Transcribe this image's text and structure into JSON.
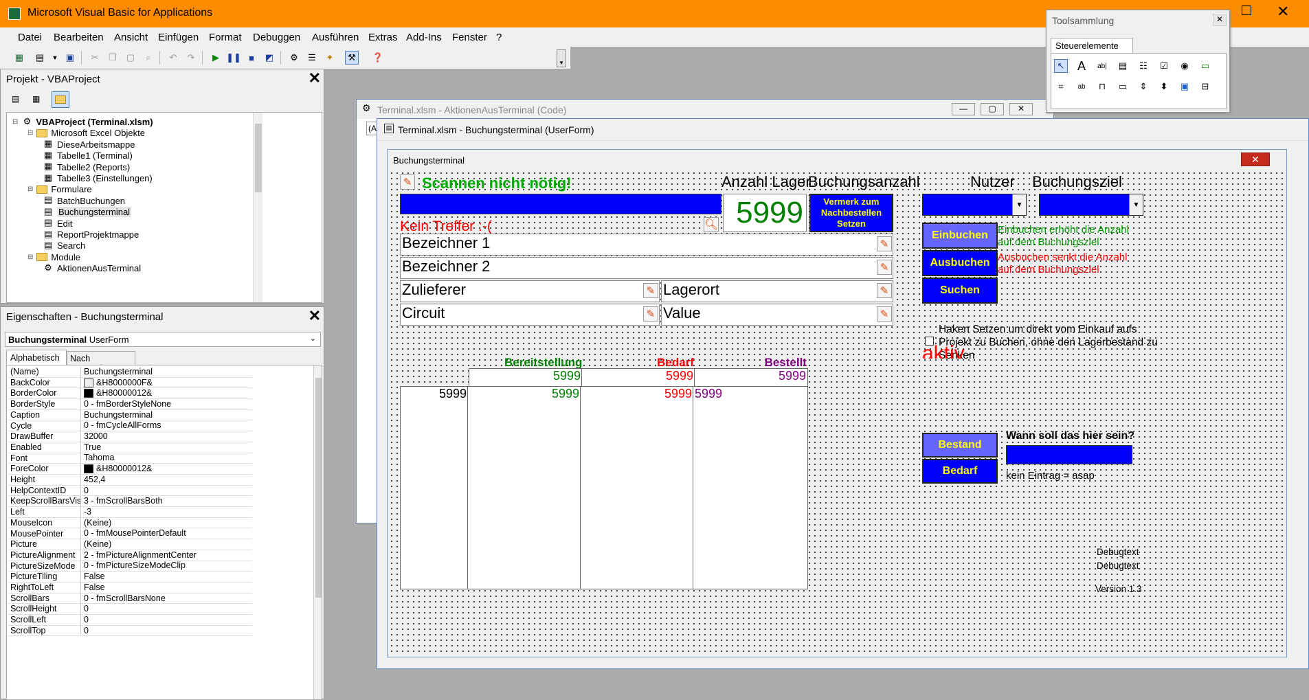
{
  "app": {
    "title": "Microsoft Visual Basic for Applications"
  },
  "menu": [
    "Datei",
    "Bearbeiten",
    "Ansicht",
    "Einfügen",
    "Format",
    "Debuggen",
    "Ausführen",
    "Extras",
    "Add-Ins",
    "Fenster",
    "?"
  ],
  "project": {
    "title": "Projekt - VBAProject",
    "tree": [
      {
        "label": "VBAProject (Terminal.xlsm)",
        "level": 0,
        "bold": true,
        "icon": "project-icon"
      },
      {
        "label": "Microsoft Excel Objekte",
        "level": 1,
        "icon": "folder-icon"
      },
      {
        "label": "DieseArbeitsmappe",
        "level": 2,
        "icon": "workbook-icon"
      },
      {
        "label": "Tabelle1 (Terminal)",
        "level": 2,
        "icon": "sheet-icon"
      },
      {
        "label": "Tabelle2 (Reports)",
        "level": 2,
        "icon": "sheet-icon"
      },
      {
        "label": "Tabelle3 (Einstellungen)",
        "level": 2,
        "icon": "sheet-icon"
      },
      {
        "label": "Formulare",
        "level": 1,
        "icon": "folder-icon"
      },
      {
        "label": "BatchBuchungen",
        "level": 2,
        "icon": "form-icon"
      },
      {
        "label": "Buchungsterminal",
        "level": 2,
        "icon": "form-icon",
        "selected": true
      },
      {
        "label": "Edit",
        "level": 2,
        "icon": "form-icon"
      },
      {
        "label": "ReportProjektmappe",
        "level": 2,
        "icon": "form-icon"
      },
      {
        "label": "Search",
        "level": 2,
        "icon": "form-icon"
      },
      {
        "label": "Module",
        "level": 1,
        "icon": "folder-icon"
      },
      {
        "label": "AktionenAusTerminal",
        "level": 2,
        "icon": "module-icon"
      }
    ]
  },
  "properties": {
    "title": "Eigenschaften - Buchungsterminal",
    "object_name": "Buchungsterminal",
    "object_type": "UserForm",
    "tabs": [
      "Alphabetisch",
      "Nach Kategorien"
    ],
    "rows": [
      {
        "name": "(Name)",
        "value": "Buchungsterminal"
      },
      {
        "name": "BackColor",
        "value": "&H8000000F&",
        "swatch": "#f0f0f0"
      },
      {
        "name": "BorderColor",
        "value": "&H80000012&",
        "swatch": "#000000"
      },
      {
        "name": "BorderStyle",
        "value": "0 - fmBorderStyleNone"
      },
      {
        "name": "Caption",
        "value": "Buchungsterminal"
      },
      {
        "name": "Cycle",
        "value": "0 - fmCycleAllForms"
      },
      {
        "name": "DrawBuffer",
        "value": "32000"
      },
      {
        "name": "Enabled",
        "value": "True"
      },
      {
        "name": "Font",
        "value": "Tahoma"
      },
      {
        "name": "ForeColor",
        "value": "&H80000012&",
        "swatch": "#000000"
      },
      {
        "name": "Height",
        "value": "452,4"
      },
      {
        "name": "HelpContextID",
        "value": "0"
      },
      {
        "name": "KeepScrollBarsVisible",
        "value": "3 - fmScrollBarsBoth"
      },
      {
        "name": "Left",
        "value": "-3"
      },
      {
        "name": "MouseIcon",
        "value": "(Keine)"
      },
      {
        "name": "MousePointer",
        "value": "0 - fmMousePointerDefault"
      },
      {
        "name": "Picture",
        "value": "(Keine)"
      },
      {
        "name": "PictureAlignment",
        "value": "2 - fmPictureAlignmentCenter"
      },
      {
        "name": "PictureSizeMode",
        "value": "0 - fmPictureSizeModeClip"
      },
      {
        "name": "PictureTiling",
        "value": "False"
      },
      {
        "name": "RightToLeft",
        "value": "False"
      },
      {
        "name": "ScrollBars",
        "value": "0 - fmScrollBarsNone"
      },
      {
        "name": "ScrollHeight",
        "value": "0"
      },
      {
        "name": "ScrollLeft",
        "value": "0"
      },
      {
        "name": "ScrollTop",
        "value": "0"
      }
    ]
  },
  "codewin": {
    "title": "Terminal.xlsm - AktionenAusTerminal (Code)",
    "combo": "(A"
  },
  "userformwin": {
    "title": "Terminal.xlsm - Buchungsterminal (UserForm)"
  },
  "form": {
    "caption": "Buchungsterminal",
    "scan_label": "Scannen nicht nötig!",
    "anzahl_lager_label": "Anzahl Lager",
    "buchungsanzahl_label": "Buchungsanzahl",
    "lager_value": "5999",
    "vermerk_button": "Vermerk zum Nachbestellen Setzen",
    "kein_treffer": "Kein Treffer :-(",
    "bezeichner1": "Bezeichner 1",
    "bezeichner2": "Bezeichner 2",
    "zulieferer": "Zulieferer",
    "lagerort": "Lagerort",
    "circuit": "Circuit",
    "value": "Value",
    "nutzer_label": "Nutzer",
    "buchungsziel_label": "Buchungsziel",
    "einbuchen_button": "Einbuchen",
    "ausbuchen_button": "Ausbuchen",
    "suchen_button": "Suchen",
    "einbuchen_hint": "Einbuchen erhöht die Anzahl auf dem Buchungsziel",
    "ausbuchen_hint": "Ausbuchen senkt die Anzahl auf dem Buchungsziel",
    "checkbox_label": "Haken Setzen um direkt vom Einkauf aufs Projekt zu Buchen, ohne den Lagerbestand zu Senken",
    "aktiv_label": "aktiv",
    "col_bereitstellung": "Bereitstellung",
    "col_bedarf": "Bedarf",
    "col_bestellt": "Bestellt",
    "head_val_bereit": "5999",
    "head_val_bedarf": "5999",
    "head_val_bestellt": "5999",
    "list_col0": "5999",
    "list_col1": "5999",
    "list_col2": "5999",
    "list_col3": "5999",
    "bestand_button": "Bestand",
    "bedarf_button": "Bedarf",
    "wann_label": "Wann soll das hier sein?",
    "kein_eintrag": "kein Eintrag = asap",
    "debug1": "Debugtext",
    "debug2": "Debugtext",
    "version": "Version 1.3"
  },
  "toolbox": {
    "title": "Toolsammlung",
    "tab": "Steuerelemente"
  },
  "colors": {
    "accent_orange": "#ff8c00",
    "form_blue": "#0000ff",
    "btn_text_yellow": "#ffff00",
    "green": "#008000",
    "red": "#ff0000",
    "purple": "#800080"
  }
}
